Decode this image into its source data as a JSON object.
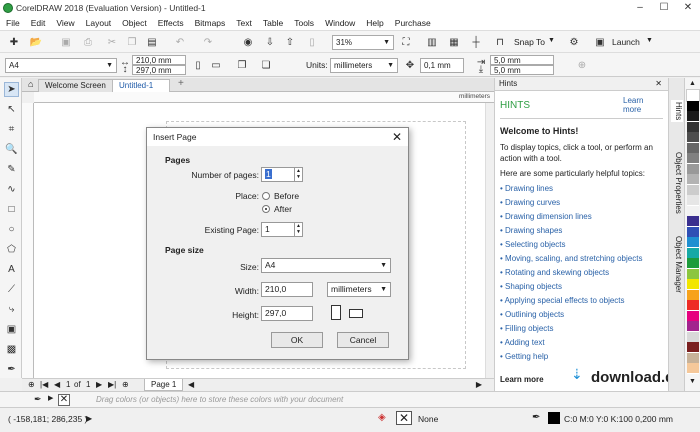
{
  "window": {
    "title": "CorelDRAW 2018 (Evaluation Version) - Untitled-1",
    "minimize": "–",
    "maximize": "☐",
    "close": "✕"
  },
  "menu": [
    "File",
    "Edit",
    "View",
    "Layout",
    "Object",
    "Effects",
    "Bitmaps",
    "Text",
    "Table",
    "Tools",
    "Window",
    "Help",
    "Purchase"
  ],
  "toolbar": {
    "zoom": "31%",
    "snap_to": "Snap To",
    "launch": "Launch"
  },
  "property_bar": {
    "page_size": "A4",
    "width": "210,0 mm",
    "height": "297,0 mm",
    "units_label": "Units:",
    "units": "millimeters",
    "nudge": "0,1 mm",
    "dup_x": "5,0 mm",
    "dup_y": "5,0 mm"
  },
  "tabs": {
    "welcome": "Welcome Screen",
    "doc": "Untitled-1",
    "add": "+"
  },
  "ruler": {
    "unit": "millimeters"
  },
  "page_nav": {
    "current": "1",
    "of": "of",
    "total": "1",
    "page_tab": "Page 1"
  },
  "palette_hint": "Drag colors (or objects) here to store these colors with your document",
  "status": {
    "coords": "( -158,181; 286,235 )",
    "fill": "None",
    "outline": "C:0 M:0 Y:0 K:100  0,200 mm"
  },
  "dialog": {
    "title": "Insert Page",
    "close": "✕",
    "pages_section": "Pages",
    "num_pages_label": "Number of pages:",
    "num_pages": "1",
    "place_label": "Place:",
    "before": "Before",
    "after": "After",
    "existing_label": "Existing Page:",
    "existing": "1",
    "size_section": "Page size",
    "size_label": "Size:",
    "size": "A4",
    "width_label": "Width:",
    "width": "210,0",
    "units": "millimeters",
    "height_label": "Height:",
    "height": "297,0",
    "ok": "OK",
    "cancel": "Cancel"
  },
  "hints_panel": {
    "header": "Hints",
    "title": "HINTS",
    "learn_more": "Learn more",
    "welcome": "Welcome to Hints!",
    "intro": "To display topics, click a tool, or perform an action with a tool.",
    "helpful": "Here are some particularly helpful topics:",
    "topics": [
      "Drawing lines",
      "Drawing curves",
      "Drawing dimension lines",
      "Drawing shapes",
      "Selecting objects",
      "Moving, scaling, and stretching objects",
      "Rotating and skewing objects",
      "Shaping objects",
      "Applying special effects to objects",
      "Outlining objects",
      "Filling objects",
      "Adding text",
      "Getting help"
    ],
    "footer": "Learn more"
  },
  "side_tabs": [
    "Hints",
    "Object Properties",
    "Object Manager"
  ],
  "watermark": "download.dk",
  "palette_colors": [
    "#ffffff",
    "#000000",
    "#1a1a1a",
    "#333333",
    "#4d4d4d",
    "#666666",
    "#808080",
    "#999999",
    "#b3b3b3",
    "#cccccc",
    "#e6e6e6",
    "#f2f2f2",
    "#3a2f8f",
    "#2f4fb5",
    "#1f8fd1",
    "#16a9a5",
    "#1d9b3a",
    "#8cc63f",
    "#f2e600",
    "#f7a21b",
    "#ee2b24",
    "#e6007e",
    "#a3238e",
    "#d9d9d9",
    "#7a1f1f",
    "#c7b299",
    "#f5c89a"
  ]
}
